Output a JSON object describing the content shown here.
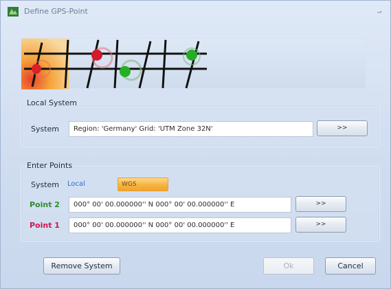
{
  "window": {
    "title": "Define GPS-Point",
    "pin_glyph": "⨼"
  },
  "local_system": {
    "group_title": "Local System",
    "system_label": "System",
    "system_value": "Region: 'Germany'   Grid: 'UTM Zone 32N'",
    "browse_label": ">>"
  },
  "enter_points": {
    "group_title": "Enter Points",
    "system_label": "System",
    "mode_local": "Local",
    "mode_wgs": "WGS",
    "points": [
      {
        "label": "Point 2",
        "value": "000° 00' 00.000000'' N 000° 00' 00.000000'' E",
        "button": ">>",
        "color": "#2e8b2e"
      },
      {
        "label": "Point 1",
        "value": "000° 00' 00.000000'' N 000° 00' 00.000000'' E",
        "button": ">>",
        "color": "#d0154a"
      }
    ]
  },
  "footer": {
    "remove_label": "Remove System",
    "ok_label": "Ok",
    "cancel_label": "Cancel"
  },
  "banner_icons": [
    "map-red-marker-icon",
    "map-red-marker-icon",
    "map-green-marker-icon",
    "map-green-marker-icon"
  ]
}
